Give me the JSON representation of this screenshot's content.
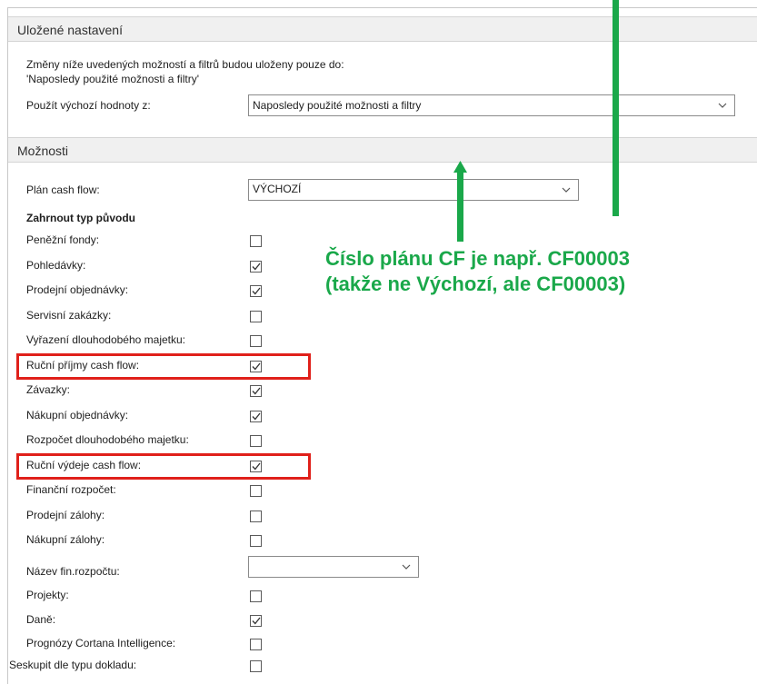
{
  "saved_settings": {
    "header": "Uložené nastavení",
    "note_line1": "Změny níže uvedených možností a filtrů budou uloženy pouze do:",
    "note_line2": "'Naposledy použité možnosti a filtry'",
    "defaults_label": "Použít výchozí hodnoty z:",
    "defaults_value": "Naposledy použité možnosti a filtry"
  },
  "options": {
    "header": "Možnosti",
    "plan_label": "Plán cash flow:",
    "plan_value": "VÝCHOZÍ",
    "include_heading": "Zahrnout typ původu",
    "items": [
      {
        "label": "Peněžní fondy:",
        "checked": false
      },
      {
        "label": "Pohledávky:",
        "checked": true
      },
      {
        "label": "Prodejní objednávky:",
        "checked": true
      },
      {
        "label": "Servisní zakázky:",
        "checked": false
      },
      {
        "label": "Vyřazení dlouhodobého majetku:",
        "checked": false
      },
      {
        "label": "Ruční příjmy cash flow:",
        "checked": true,
        "highlighted": true
      },
      {
        "label": "Závazky:",
        "checked": true
      },
      {
        "label": "Nákupní objednávky:",
        "checked": true
      },
      {
        "label": "Rozpočet dlouhodobého majetku:",
        "checked": false
      },
      {
        "label": "Ruční výdeje cash flow:",
        "checked": true,
        "highlighted": true
      },
      {
        "label": "Finanční rozpočet:",
        "checked": false
      },
      {
        "label": "Prodejní zálohy:",
        "checked": false
      },
      {
        "label": "Nákupní zálohy:",
        "checked": false
      }
    ],
    "budget_name_label": "Název fin.rozpočtu:",
    "budget_name_value": "",
    "items2": [
      {
        "label": "Projekty:",
        "checked": false
      },
      {
        "label": "Daně:",
        "checked": true
      },
      {
        "label": "Prognózy Cortana Intelligence:",
        "checked": false
      }
    ],
    "group_label": "Seskupit dle typu dokladu:",
    "group_checked": false
  },
  "annotation": {
    "line1": "Číslo plánu CF je např. CF00003",
    "line2": "(takže ne Výchozí, ale CF00003)",
    "color": "#1aa84a",
    "highlight_color": "#e0201a"
  }
}
